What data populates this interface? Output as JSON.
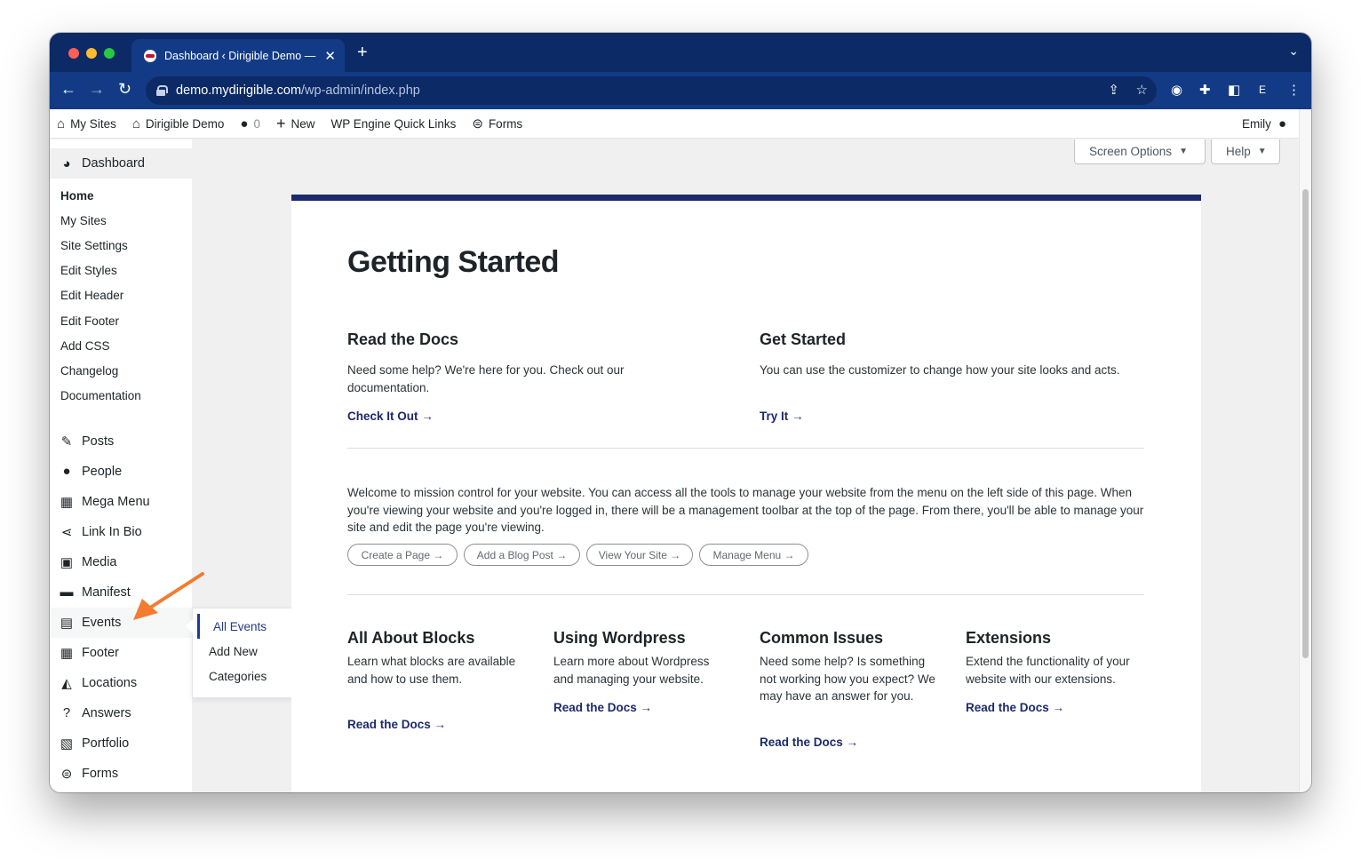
{
  "browser": {
    "tab_title": "Dashboard ‹ Dirigible Demo —",
    "tab_close": "✕",
    "new_tab": "+",
    "url_host": "demo.mydirigible.com",
    "url_path": "/wp-admin/index.php",
    "profile_initial": "E"
  },
  "adminbar": {
    "my_sites": "My Sites",
    "site_name": "Dirigible Demo",
    "comments_count": "0",
    "new": "New",
    "wpengine": "WP Engine Quick Links",
    "forms": "Forms",
    "user": "Emily"
  },
  "sidebar": {
    "dashboard": "Dashboard",
    "submenu": [
      "Home",
      "My Sites",
      "Site Settings",
      "Edit Styles",
      "Edit Header",
      "Edit Footer",
      "Add CSS",
      "Changelog",
      "Documentation"
    ],
    "items": [
      "Posts",
      "People",
      "Mega Menu",
      "Link In Bio",
      "Media",
      "Manifest",
      "Events",
      "Footer",
      "Locations",
      "Answers",
      "Portfolio",
      "Forms"
    ]
  },
  "flyout": [
    "All Events",
    "Add New",
    "Categories"
  ],
  "screen_options": "Screen Options",
  "help": "Help",
  "main": {
    "title": "Getting Started",
    "docs_title": "Read the Docs",
    "docs_text": "Need some help? We're here for you. Check out our documentation.",
    "docs_link": "Check It Out →",
    "started_title": "Get Started",
    "started_text": "You can use the customizer to change how your site looks and acts.",
    "started_link": "Try It →",
    "welcome": "Welcome to mission control for your website. You can access all the tools to manage your website from the menu on the left side of this page. When you're viewing your website and you're logged in, there will be a management toolbar at the top of the page. From there, you'll be able to manage your site and edit the page you're viewing.",
    "pills": [
      "Create a Page →",
      "Add a Blog Post →",
      "View Your Site →",
      "Manage Menu →"
    ],
    "cols": [
      {
        "title": "All About Blocks",
        "text": "Learn what blocks are available and how to use them.",
        "link": "Read the Docs →"
      },
      {
        "title": "Using Wordpress",
        "text": "Learn more about Wordpress and managing your website.",
        "link": "Read the Docs →"
      },
      {
        "title": "Common Issues",
        "text": "Need some help? Is something not working how you expect? We may have an answer for you.",
        "link": "Read the Docs →"
      },
      {
        "title": "Extensions",
        "text": "Extend the functionality of your website with our extensions.",
        "link": "Read the Docs →"
      }
    ]
  },
  "colors": {
    "accent": "#1c2a6b",
    "chrome": "#0b2a66",
    "annotation": "#f47b30"
  }
}
